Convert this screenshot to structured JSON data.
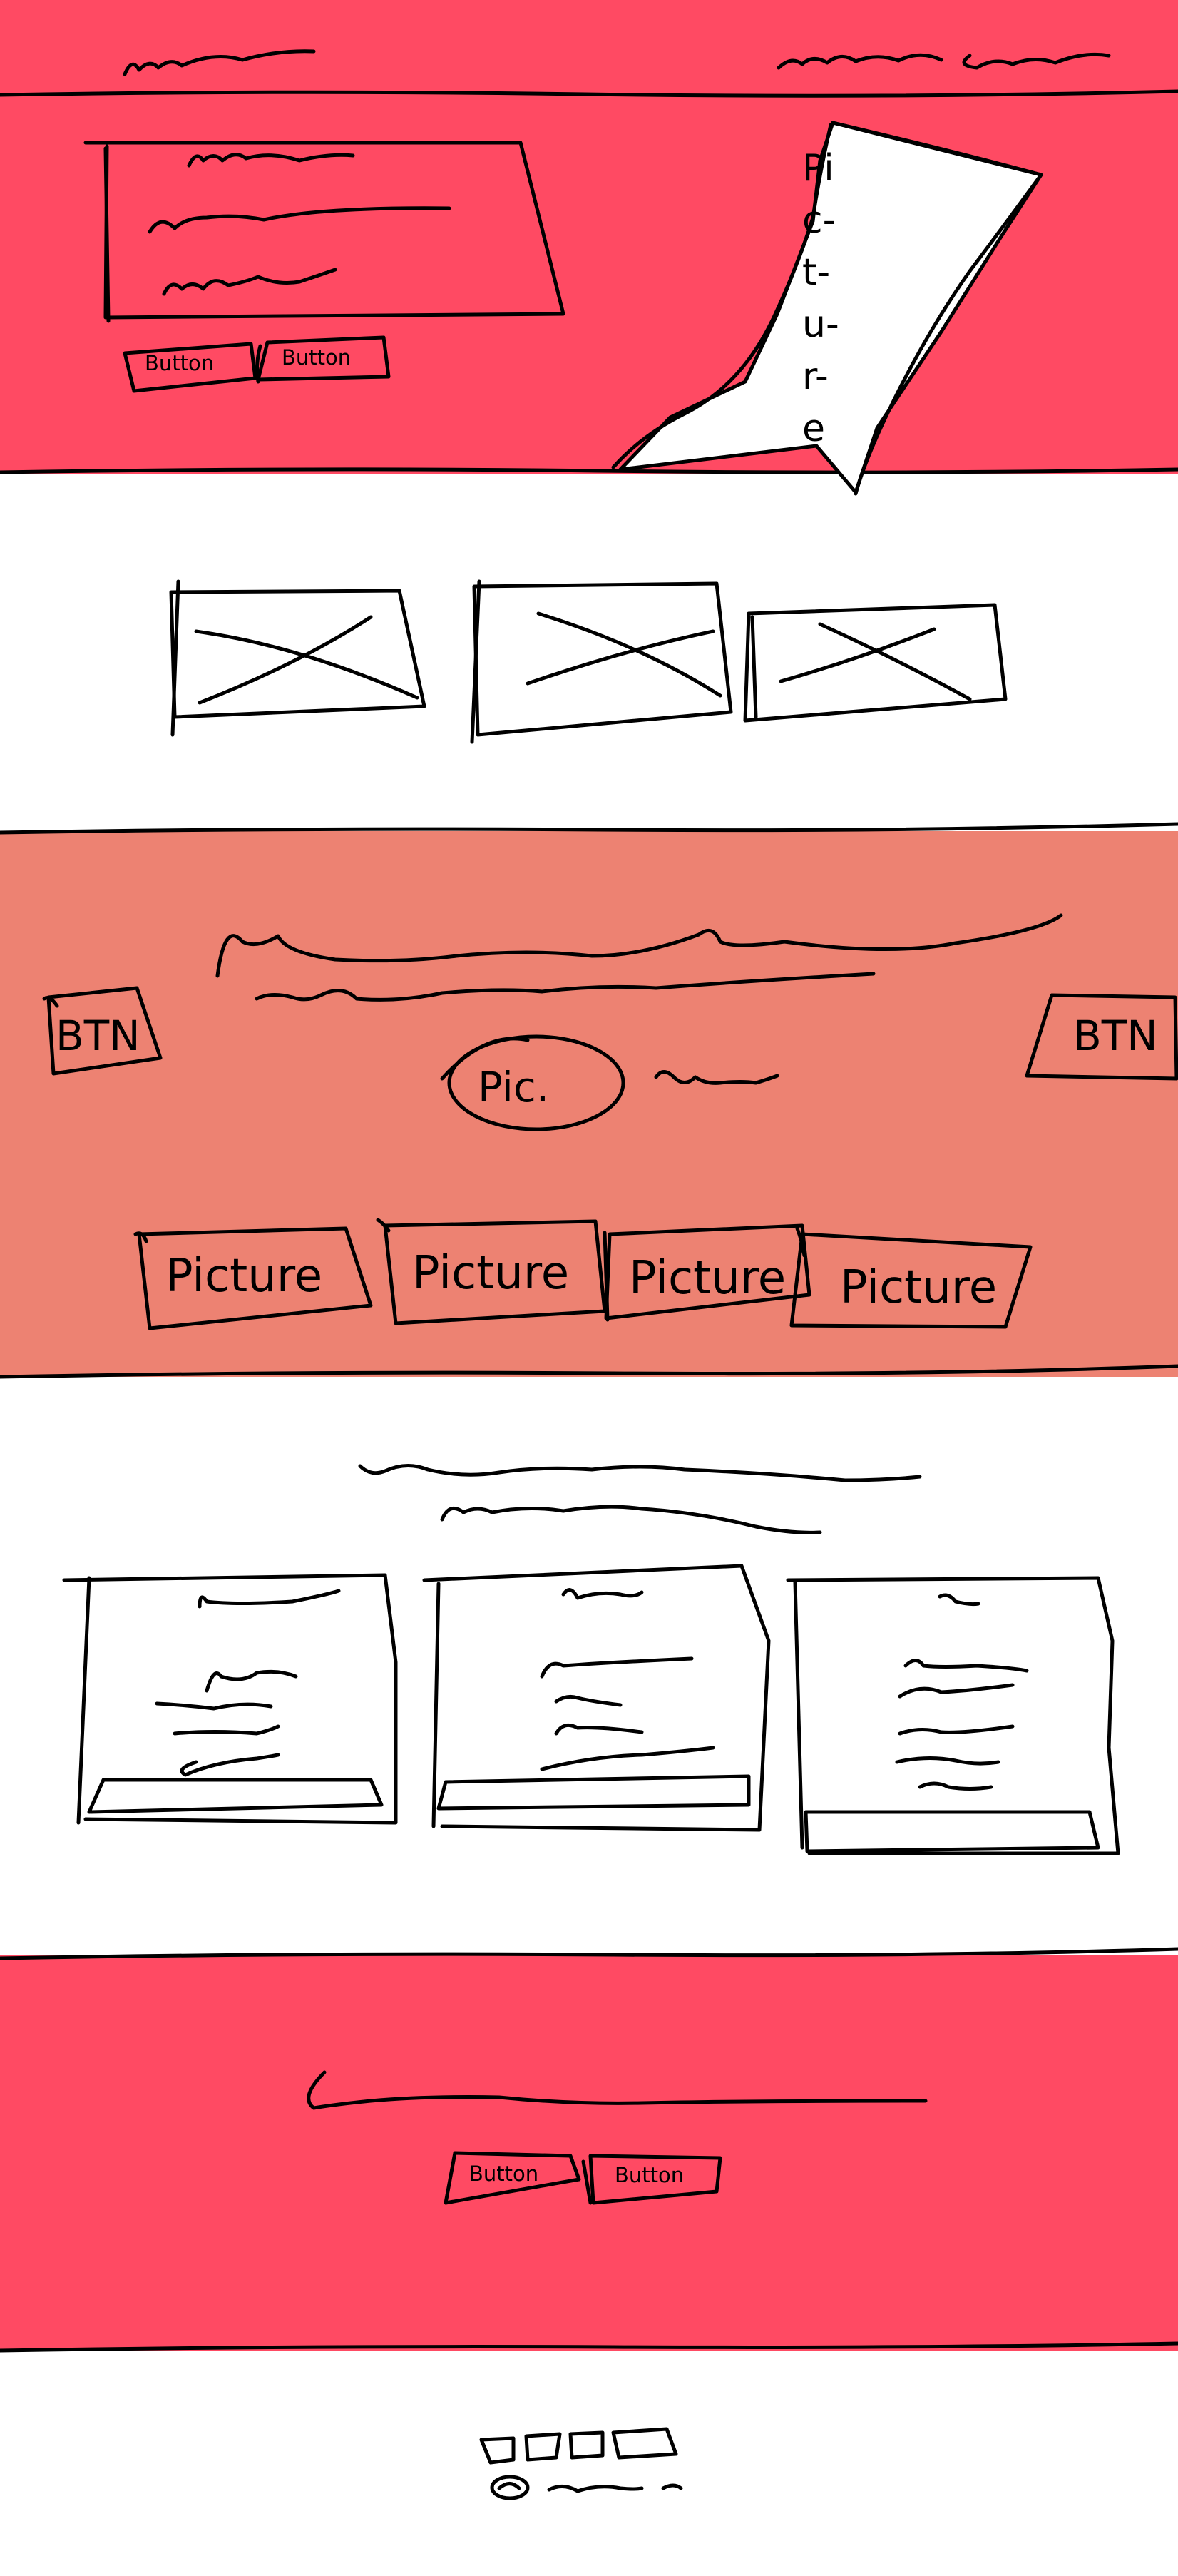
{
  "colors": {
    "primary_band": "#FF4A63",
    "secondary_band": "#ED8272",
    "background": "#FFFFFF",
    "ink": "#000000",
    "picture_fill": "#FFFFFF"
  },
  "hero": {
    "picture_letters": [
      "Pi",
      "c-",
      "t-",
      "u-",
      "r-",
      "e"
    ],
    "buttons": [
      "Button",
      "Button"
    ]
  },
  "feature_band": {
    "left_button": "BTN",
    "right_button": "BTN",
    "circle_picture": "Pic.",
    "pictures": [
      "Picture",
      "Picture",
      "Picture",
      "Picture"
    ]
  },
  "cta_band": {
    "buttons": [
      "Button",
      "Button"
    ]
  }
}
